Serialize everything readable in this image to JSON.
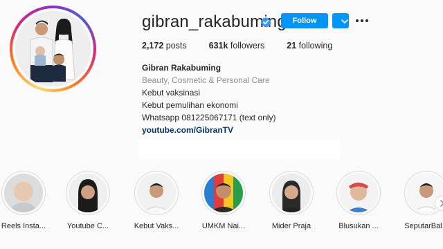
{
  "profile": {
    "username": "gibran_rakabuming",
    "follow_label": "Follow",
    "stats": {
      "posts_count": "2,172",
      "posts_label": " posts",
      "followers_count": "631k",
      "followers_label": " followers",
      "following_count": "21",
      "following_label": " following"
    },
    "bio": {
      "full_name": "Gibran Rakabuming",
      "category": "Beauty, Cosmetic & Personal Care",
      "lines": [
        "Kebut vaksinasi",
        "Kebut pemulihan ekonomi",
        "Whatsapp 081225067171 (text only)"
      ],
      "link": "youtube.com/GibranTV"
    }
  },
  "highlights": [
    {
      "label": "Reels Insta..."
    },
    {
      "label": "Youtube C..."
    },
    {
      "label": "Kebut Vaks..."
    },
    {
      "label": "UMKM Nai..."
    },
    {
      "label": "Mider Praja"
    },
    {
      "label": "Blusukan ..."
    },
    {
      "label": "SeputarBal..."
    }
  ],
  "icons": {
    "verified": "verified-badge-icon",
    "dropdown": "chevron-down-icon",
    "more": "more-horizontal-icon"
  },
  "colors": {
    "accent": "#0095f6",
    "link": "#00376b",
    "muted": "#8e8e8e"
  }
}
